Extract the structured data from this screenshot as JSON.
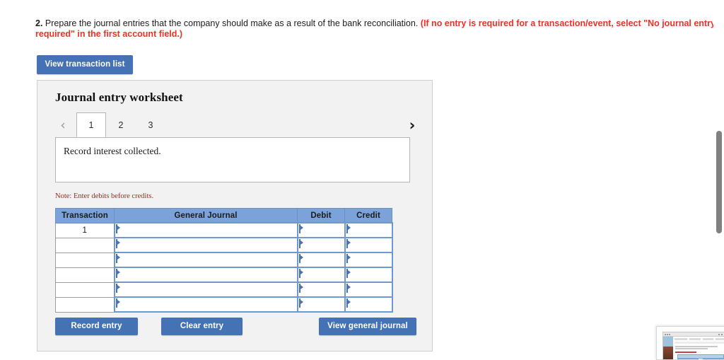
{
  "question": {
    "number": "2.",
    "text": " Prepare the journal entries that the company should make as a result of the bank reconciliation. ",
    "red_note": "(If no entry is required for a transaction/event, select \"No journal entry required\" in the first account field.)"
  },
  "toolbar": {
    "view_transaction_list_label": "View transaction list"
  },
  "worksheet": {
    "title": "Journal entry worksheet",
    "nav": {
      "prev_icon": "chevron-left-icon",
      "next_icon": "chevron-right-icon",
      "prev_glyph": "‹",
      "next_glyph": "›"
    },
    "tabs": [
      {
        "label": "1",
        "active": true
      },
      {
        "label": "2",
        "active": false
      },
      {
        "label": "3",
        "active": false
      }
    ],
    "description": "Record interest collected.",
    "note": "Note: Enter debits before credits."
  },
  "table": {
    "headers": [
      "Transaction",
      "General Journal",
      "Debit",
      "Credit"
    ],
    "rows": [
      {
        "transaction": "1",
        "general_journal": "",
        "debit": "",
        "credit": ""
      },
      {
        "transaction": "",
        "general_journal": "",
        "debit": "",
        "credit": ""
      },
      {
        "transaction": "",
        "general_journal": "",
        "debit": "",
        "credit": ""
      },
      {
        "transaction": "",
        "general_journal": "",
        "debit": "",
        "credit": ""
      },
      {
        "transaction": "",
        "general_journal": "",
        "debit": "",
        "credit": ""
      },
      {
        "transaction": "",
        "general_journal": "",
        "debit": "",
        "credit": ""
      }
    ]
  },
  "actions": {
    "record_entry_label": "Record entry",
    "clear_entry_label": "Clear entry",
    "view_general_journal_label": "View general journal"
  },
  "colors": {
    "button_blue": "#4472b4",
    "header_blue": "#7ba3d9",
    "input_border_blue": "#6e99cf",
    "alert_red": "#ef3124",
    "note_red": "#9e2a24",
    "panel_gray": "#f2f2f2",
    "scrollbar_gray": "#808080"
  }
}
